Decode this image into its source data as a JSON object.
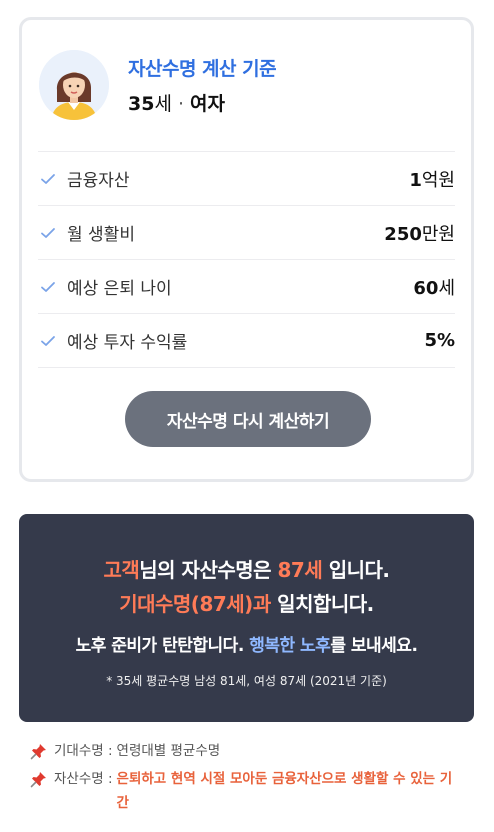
{
  "profile": {
    "title": "자산수명 계산 기준",
    "age_number": "35",
    "age_unit": "세",
    "separator": "·",
    "gender": "여자"
  },
  "criteria": [
    {
      "label": "금융자산",
      "value_number": "1",
      "value_unit": "억원"
    },
    {
      "label": "월 생활비",
      "value_number": "250",
      "value_unit": "만원"
    },
    {
      "label": "예상 은퇴 나이",
      "value_number": "60",
      "value_unit": "세"
    },
    {
      "label": "예상 투자 수익률",
      "value_number": "5%",
      "value_unit": ""
    }
  ],
  "recalc_button": "자산수명 다시 계산하기",
  "result": {
    "line1": [
      "고객",
      "님의 자산수명은 ",
      "87세",
      " 입니다."
    ],
    "line2": [
      "기대수명(87세)과",
      " 일치합니다."
    ],
    "line3": [
      "노후 준비가 탄탄합니다. ",
      "행복한 노후",
      "를 보내세요."
    ],
    "footnote": "* 35세 평균수명 남성 81세, 여성 87세 (2021년 기준)"
  },
  "notes": [
    {
      "key": "기대수명 :",
      "value": "연령대별 평균수명"
    },
    {
      "key": "자산수명 :",
      "value": "은퇴하고 현역 시절 모아둔 금융자산으로 생활할 수 있는 기간"
    }
  ],
  "colors": {
    "accent_blue": "#2f6fe0",
    "highlight_orange": "#ff7b57",
    "highlight_blue": "#8fb8ff",
    "result_bg": "#353a4b",
    "button_bg": "#6b717d",
    "note_red": "#e8623b"
  },
  "icons": {
    "avatar": "woman-avatar-icon",
    "row_check": "check-icon",
    "note_pin": "pushpin-icon"
  }
}
